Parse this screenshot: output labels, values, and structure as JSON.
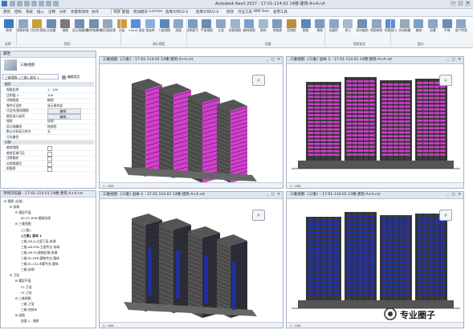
{
  "titlebar": {
    "app_title": "Autodesk Revit 2017 -    17-01-114-01 14楼-建筑-A+A.rvt",
    "window_buttons": [
      "—",
      "□",
      "✕"
    ]
  },
  "tabs": [
    "建筑",
    "结构",
    "系统",
    "插入",
    "注释",
    "分析",
    "体量和场地",
    "协作",
    "视图",
    "管理",
    "附加模块",
    "Lumion",
    "族库大师V2.0",
    "族库大师V2.0",
    "修改",
    "鸿业工具",
    "BIM Ooo",
    "速用工具"
  ],
  "ribbon": {
    "buttons": [
      "修改",
      "视图样板",
      "可见性/图形",
      "过滤器",
      "细线",
      "显示隐藏线",
      "删除隐藏线",
      "剖切面轮廓",
      "渲染",
      "Cloud 渲染",
      "渲染库",
      "三维视图",
      "剖面",
      "详图索引",
      "平面视图",
      "立面",
      "绘图视图",
      "复制视图",
      "图例",
      "明细表",
      "范围框",
      "图纸",
      "视图",
      "标题栏",
      "修订",
      "导向轴网",
      "视图参照",
      "切换窗口",
      "关闭隐藏",
      "复制",
      "层叠",
      "平铺",
      "用户界面"
    ],
    "groups": [
      "选择",
      "图形",
      "演示视图",
      "创建",
      "图纸组合",
      "窗口"
    ]
  },
  "properties": {
    "header": "属性",
    "type_name": "三维视图",
    "selector": "三维视图: {三维} 副本 1",
    "edit_type": "编辑类型",
    "category": "图形",
    "rows": [
      {
        "k": "视图比例",
        "v": "1 : 100"
      },
      {
        "k": "比例值 1:",
        "v": "100"
      },
      {
        "k": "详细程度",
        "v": "精细"
      },
      {
        "k": "零件可见性",
        "v": "显示原状态"
      },
      {
        "k": "可见性/图形替换",
        "v": "编辑..."
      },
      {
        "k": "图形显示选项",
        "v": "编辑..."
      },
      {
        "k": "规程",
        "v": "协调"
      },
      {
        "k": "显示隐藏线",
        "v": "按规程"
      },
      {
        "k": "默认分析显示样式",
        "v": "无"
      },
      {
        "k": "日光路径",
        "v": ""
      }
    ],
    "category2": "范围",
    "rows2": [
      {
        "k": "裁剪视图",
        "v": ""
      },
      {
        "k": "裁剪区域可见",
        "v": ""
      },
      {
        "k": "注释裁剪",
        "v": ""
      },
      {
        "k": "远剪裁激活",
        "v": ""
      },
      {
        "k": "剖面框",
        "v": ""
      }
    ]
  },
  "browser": {
    "header": "项目浏览器 - 17-01-114-01 14楼-建筑-A+A.rvt",
    "items": [
      {
        "t": "视图 (全部)",
        "lvl": 0
      },
      {
        "t": "协调",
        "lvl": 1
      },
      {
        "t": "楼层平面",
        "lvl": 2
      },
      {
        "t": "B1-E1-DYB-楼板协调",
        "lvl": 3
      },
      {
        "t": "三维视图",
        "lvl": 2
      },
      {
        "t": "{三维}",
        "lvl": 3
      },
      {
        "t": "{三维} 副本 1",
        "lvl": 3
      },
      {
        "t": "三维-AR-A-立面下层-协调",
        "lvl": 3
      },
      {
        "t": "三维-AR-PYB-立面专业-协调",
        "lvl": 3
      },
      {
        "t": "三维-AR-TX-楼梯区域-协调",
        "lvl": 3
      },
      {
        "t": "三维-EL-DYB-建筑专业-整体",
        "lvl": 3
      },
      {
        "t": "三维-EL-CZJ-水暖专业-整体",
        "lvl": 3
      },
      {
        "t": "三维-协调",
        "lvl": 3
      },
      {
        "t": "卫浴",
        "lvl": 1
      },
      {
        "t": "楼层平面",
        "lvl": 2
      },
      {
        "t": "F1-卫浴",
        "lvl": 3
      },
      {
        "t": "F2-卫浴",
        "lvl": 3
      },
      {
        "t": "三维视图",
        "lvl": 2
      },
      {
        "t": "三维-卫浴",
        "lvl": 3
      },
      {
        "t": "三维-给排水",
        "lvl": 3
      },
      {
        "t": "剖面",
        "lvl": 2
      },
      {
        "t": "剖面 1 - 图纸",
        "lvl": 3
      }
    ]
  },
  "views": [
    {
      "title": "三维视图: {三维} - 17-01-114-01 14楼-建筑-A+A.rvt",
      "scale": "1 : 100"
    },
    {
      "title": "三维视图: {三维} 副本 1 - 17-01-114-01 14楼-建筑-A+A.rvt",
      "scale": "1 : 100"
    },
    {
      "title": "三维视图: {三维} 副本 1 - 17-01-114-01 14楼-建筑-A+A.rvt",
      "scale": "1 : 100"
    },
    {
      "title": "三维视图: {三维} - 17-01-114-01 14楼-建筑-A+A.rvt",
      "scale": "1 : 100"
    }
  ],
  "watermark": {
    "text": "专业圈子"
  },
  "colors": {
    "magenta": "#d43fd0",
    "blue": "#1f2fb5",
    "dark": "#3a3a3a",
    "accent": "#2b6cb0"
  }
}
